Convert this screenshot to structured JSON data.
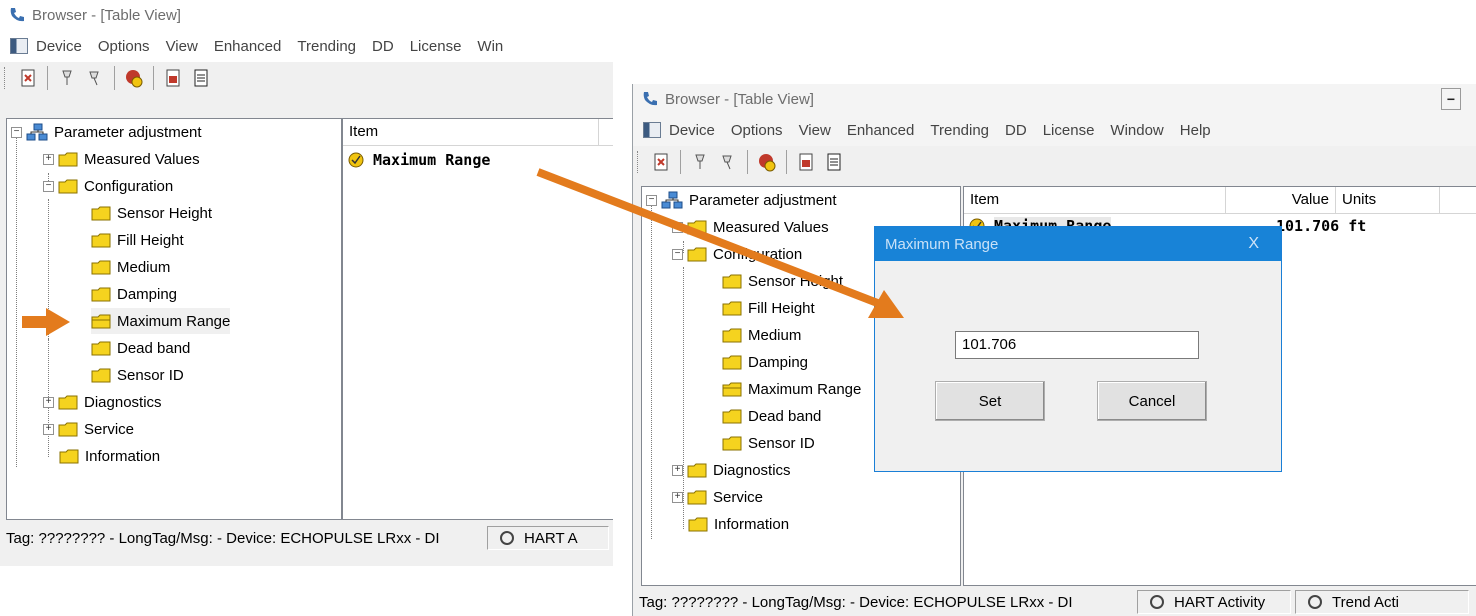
{
  "left_window": {
    "title": "Browser - [Table View]",
    "menu": [
      "Device",
      "Options",
      "View",
      "Enhanced",
      "Trending",
      "DD",
      "License",
      "Win"
    ],
    "tree": {
      "root": "Parameter adjustment",
      "items": [
        "Measured Values",
        "Configuration",
        "Sensor Height",
        "Fill Height",
        "Medium",
        "Damping",
        "Maximum Range",
        "Dead band",
        "Sensor ID",
        "Diagnostics",
        "Service",
        "Information"
      ]
    },
    "list": {
      "col_item": "Item",
      "row_label": "Maximum Range"
    },
    "status": {
      "tag": "Tag: ???????? - LongTag/Msg:  - Device: ECHOPULSE LRxx - DI",
      "hart": "HART A"
    }
  },
  "right_window": {
    "title": "Browser - [Table View]",
    "menu": [
      "Device",
      "Options",
      "View",
      "Enhanced",
      "Trending",
      "DD",
      "License",
      "Window",
      "Help"
    ],
    "tree": {
      "root": "Parameter adjustment",
      "items": [
        "Measured Values",
        "Configuration",
        "Sensor Height",
        "Fill Height",
        "Medium",
        "Damping",
        "Maximum Range",
        "Dead band",
        "Sensor ID",
        "Diagnostics",
        "Service",
        "Information"
      ]
    },
    "list": {
      "col_item": "Item",
      "col_value": "Value",
      "col_units": "Units",
      "row_label": "Maximum Range",
      "row_value": "101.706 ft"
    },
    "status": {
      "tag": "Tag: ???????? - LongTag/Msg:  - Device: ECHOPULSE LRxx - DI",
      "hart": "HART Activity",
      "trend": "Trend Acti"
    }
  },
  "dialog": {
    "title": "Maximum Range",
    "close": "X",
    "input_value": "101.706",
    "set_label": "Set",
    "cancel_label": "Cancel"
  },
  "colors": {
    "arrow": "#e37b1d",
    "dialog_title_bg": "#1883d7",
    "folder": "#f5d31f"
  }
}
